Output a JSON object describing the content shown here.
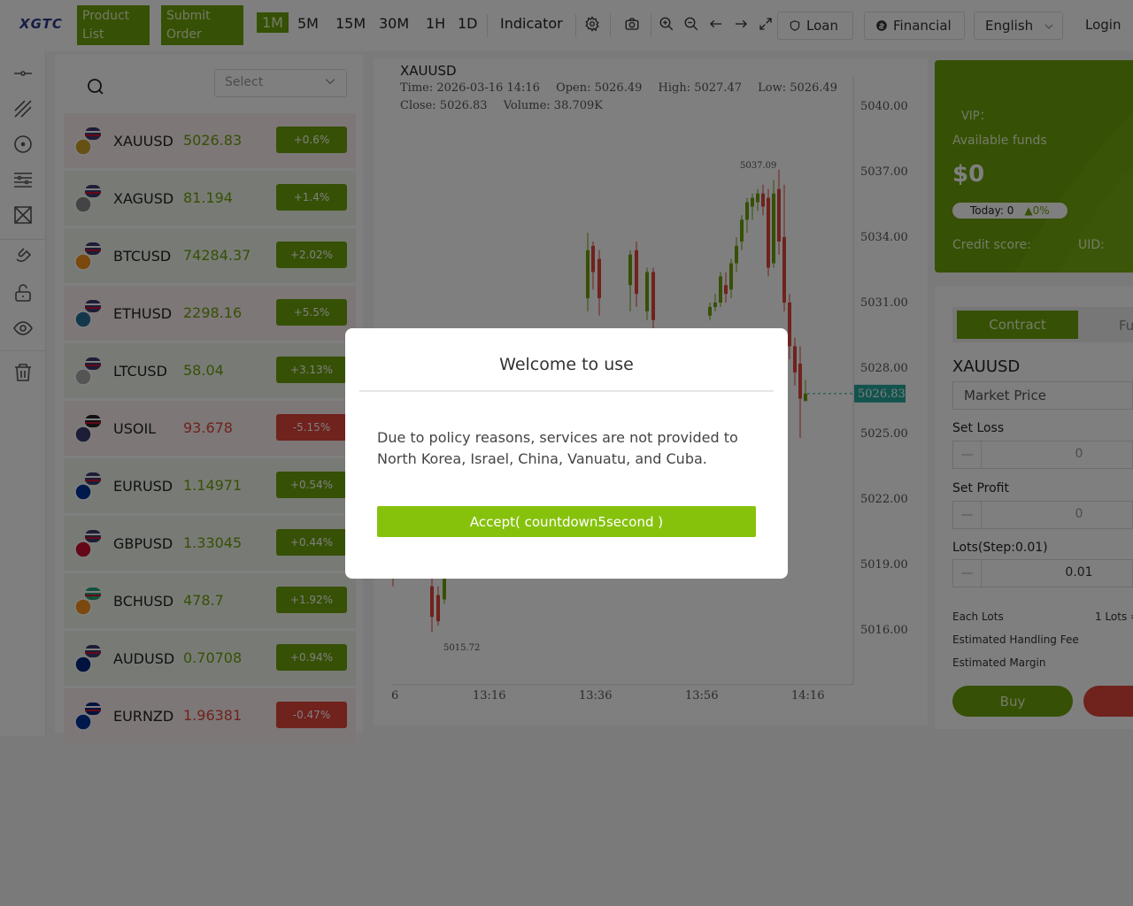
{
  "brand": {
    "logo_text": "XGTC"
  },
  "header": {
    "product_list_label": "Product List",
    "submit_order_label": "Submit Order",
    "timeframes": [
      "1M",
      "5M",
      "15M",
      "30M",
      "1H",
      "1D"
    ],
    "active_timeframe": "1M",
    "indicator_label": "Indicator",
    "toolbar_icons": [
      "gear-icon",
      "camera-icon",
      "zoom-in-icon",
      "zoom-out-icon",
      "arrow-left-icon",
      "arrow-right-icon",
      "fullscreen-icon"
    ],
    "loan_label": "Loan",
    "financial_label": "Financial",
    "language_label": "English",
    "login_label": "Login"
  },
  "left_tools": [
    "horizontal-line-icon",
    "trend-line-icon",
    "circle-icon",
    "fib-lines-icon",
    "pattern-icon",
    "magnet-icon",
    "lock-icon",
    "eye-icon",
    "trash-icon"
  ],
  "product_list": {
    "select_placeholder": "Select",
    "items": [
      {
        "symbol": "XAUUSD",
        "price": "5026.83",
        "change": "+0.6%",
        "direction": "down"
      },
      {
        "symbol": "XAGUSD",
        "price": "81.194",
        "change": "+1.4%",
        "direction": "up"
      },
      {
        "symbol": "BTCUSD",
        "price": "74284.37",
        "change": "+2.02%",
        "direction": "up"
      },
      {
        "symbol": "ETHUSD",
        "price": "2298.16",
        "change": "+5.5%",
        "direction": "down"
      },
      {
        "symbol": "LTCUSD",
        "price": "58.04",
        "change": "+3.13%",
        "direction": "up"
      },
      {
        "symbol": "USOIL",
        "price": "93.678",
        "change": "-5.15%",
        "direction": "down"
      },
      {
        "symbol": "EURUSD",
        "price": "1.14971",
        "change": "+0.54%",
        "direction": "up"
      },
      {
        "symbol": "GBPUSD",
        "price": "1.33045",
        "change": "+0.44%",
        "direction": "up"
      },
      {
        "symbol": "BCHUSD",
        "price": "478.7",
        "change": "+1.92%",
        "direction": "up"
      },
      {
        "symbol": "AUDUSD",
        "price": "0.70708",
        "change": "+0.94%",
        "direction": "up"
      },
      {
        "symbol": "EURNZD",
        "price": "1.96381",
        "change": "-0.47%",
        "direction": "down"
      }
    ]
  },
  "chart": {
    "symbol": "XAUUSD",
    "time": "Time: 2026-03-16 14:16",
    "open": "Open: 5026.49",
    "high": "High: 5027.47",
    "low": "Low: 5026.49",
    "close": "Close: 5026.83",
    "volume": "Volume: 38.709K",
    "last_price_tag": "5026.83",
    "high_marker": "5037.09",
    "low_marker": "5015.72",
    "y_ticks": [
      "5040.00",
      "5037.00",
      "5034.00",
      "5031.00",
      "5028.00",
      "5025.00",
      "5022.00",
      "5019.00",
      "5016.00"
    ],
    "x_ticks": [
      "6",
      "13:16",
      "13:36",
      "13:56",
      "14:16"
    ],
    "up_color": "#6da00a",
    "down_color": "#e0453a"
  },
  "account": {
    "vip_label": "VIP：",
    "available_funds_label": "Available funds",
    "available_funds_value": "$0",
    "today_label": "Today: 0",
    "today_pct": "0%",
    "credit_score_label": "Credit score:",
    "uid_label": "UID:"
  },
  "order": {
    "tab_contract": "Contract",
    "tab_other": "Fu",
    "symbol": "XAUUSD",
    "order_type": "Market Price",
    "set_loss_label": "Set Loss",
    "set_loss_value": "0",
    "set_profit_label": "Set Profit",
    "set_profit_value": "0",
    "lots_label": "Lots(Step:0.01)",
    "lots_value": "0.01",
    "each_lots_label": "Each Lots",
    "each_lots_value": "1 Lots =",
    "handling_fee_label": "Estimated Handling Fee",
    "margin_label": "Estimated Margin",
    "buy_label": "Buy"
  },
  "modal": {
    "title": "Welcome to use",
    "body": "Due to policy reasons, services are not provided to North Korea, Israel, China, Vanuatu, and Cuba.",
    "accept_label": "Accept( countdown5second )"
  }
}
